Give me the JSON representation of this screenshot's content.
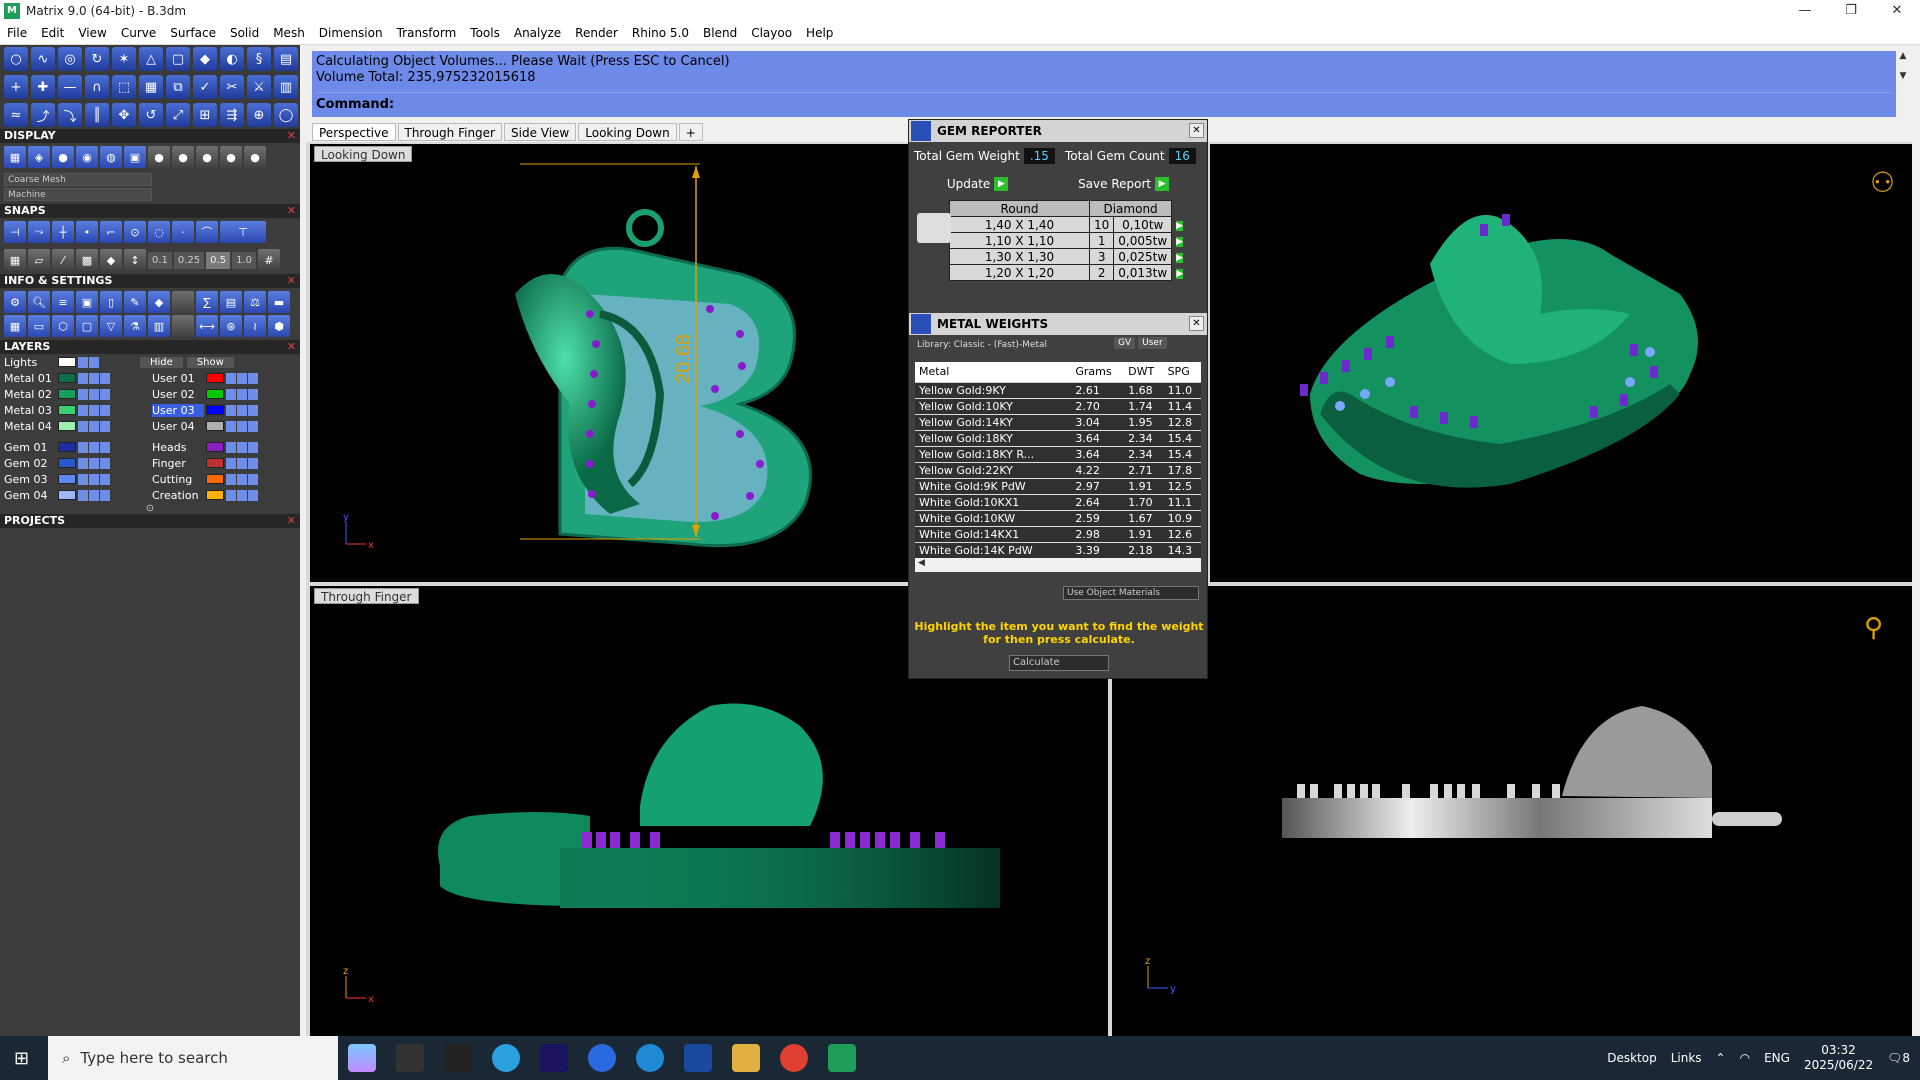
{
  "window": {
    "title": "Matrix 9.0 (64-bit) - B.3dm",
    "controls": {
      "minimize": "—",
      "maximize": "❐",
      "close": "✕"
    }
  },
  "menu": [
    "File",
    "Edit",
    "View",
    "Curve",
    "Surface",
    "Solid",
    "Mesh",
    "Dimension",
    "Transform",
    "Tools",
    "Analyze",
    "Render",
    "Rhino 5.0",
    "Blend",
    "Clayoo",
    "Help"
  ],
  "command": {
    "line1": "Calculating Object Volumes... Please Wait (Press ESC to Cancel)",
    "line2": "Volume Total: 235,975232015618",
    "prompt": "Command:"
  },
  "panels": {
    "display": {
      "title": "DISPLAY",
      "mesh": "Coarse Mesh",
      "material": "Machine"
    },
    "snaps": {
      "title": "SNAPS",
      "values": [
        "0.1",
        "0.25",
        "0.5",
        "1.0"
      ]
    },
    "info": {
      "title": "INFO & SETTINGS"
    },
    "layers": {
      "title": "LAYERS",
      "lights": "Lights",
      "hide": "Hide",
      "show": "Show",
      "left": [
        {
          "name": "Metal 01",
          "color": "#0f6e4a"
        },
        {
          "name": "Metal 02",
          "color": "#16a05a"
        },
        {
          "name": "Metal 03",
          "color": "#3ad070"
        },
        {
          "name": "Metal 04",
          "color": "#9ff0b0"
        },
        {
          "name": "Gem 01",
          "color": "#1a2fa0"
        },
        {
          "name": "Gem 02",
          "color": "#2858d0"
        },
        {
          "name": "Gem 03",
          "color": "#5a8af0"
        },
        {
          "name": "Gem 04",
          "color": "#9ab8f8"
        }
      ],
      "right": [
        {
          "name": "User 01",
          "color": "#ff0000"
        },
        {
          "name": "User 02",
          "color": "#00cc00"
        },
        {
          "name": "User 03",
          "color": "#0000ff",
          "selected": true
        },
        {
          "name": "User 04",
          "color": "#b0b0b0"
        },
        {
          "name": "Heads",
          "color": "#8a20c0"
        },
        {
          "name": "Finger",
          "color": "#c03030"
        },
        {
          "name": "Cutting",
          "color": "#ff6a00"
        },
        {
          "name": "Creation",
          "color": "#ffb000"
        }
      ]
    },
    "projects": {
      "title": "PROJECTS"
    }
  },
  "viewport_tabs": [
    "Perspective",
    "Through Finger",
    "Side View",
    "Looking Down",
    "+"
  ],
  "viewports": {
    "top_left": {
      "label": "Looking Down",
      "dimension": "20.68"
    },
    "bottom_left": {
      "label": "Through Finger"
    }
  },
  "gem_reporter": {
    "title": "GEM REPORTER",
    "total_weight_label": "Total Gem Weight",
    "total_weight": ".15",
    "total_count_label": "Total Gem Count",
    "total_count": "16",
    "update": "Update",
    "save_report": "Save Report",
    "headers": [
      "Round",
      "Diamond"
    ],
    "rows": [
      {
        "size": "1,40 X 1,40",
        "count": "10",
        "weight": "0,10tw"
      },
      {
        "size": "1,10 X 1,10",
        "count": "1",
        "weight": "0,005tw"
      },
      {
        "size": "1,30 X 1,30",
        "count": "3",
        "weight": "0,025tw"
      },
      {
        "size": "1,20 X 1,20",
        "count": "2",
        "weight": "0,013tw"
      }
    ]
  },
  "metal_weights": {
    "title": "METAL WEIGHTS",
    "library": "Library: Classic - (Fast)-Metal",
    "gv": "GV",
    "user": "User",
    "columns": [
      "Metal",
      "Grams",
      "DWT",
      "SPG"
    ],
    "rows": [
      {
        "metal": "Yellow Gold:9KY",
        "grams": "2.61",
        "dwt": "1.68",
        "spg": "11.0"
      },
      {
        "metal": "Yellow Gold:10KY",
        "grams": "2.70",
        "dwt": "1.74",
        "spg": "11.4"
      },
      {
        "metal": "Yellow Gold:14KY",
        "grams": "3.04",
        "dwt": "1.95",
        "spg": "12.8"
      },
      {
        "metal": "Yellow Gold:18KY",
        "grams": "3.64",
        "dwt": "2.34",
        "spg": "15.4"
      },
      {
        "metal": "Yellow Gold:18KY R...",
        "grams": "3.64",
        "dwt": "2.34",
        "spg": "15.4"
      },
      {
        "metal": "Yellow Gold:22KY",
        "grams": "4.22",
        "dwt": "2.71",
        "spg": "17.8"
      },
      {
        "metal": "White Gold:9K PdW",
        "grams": "2.97",
        "dwt": "1.91",
        "spg": "12.5"
      },
      {
        "metal": "White Gold:10KX1",
        "grams": "2.64",
        "dwt": "1.70",
        "spg": "11.1"
      },
      {
        "metal": "White Gold:10KW",
        "grams": "2.59",
        "dwt": "1.67",
        "spg": "10.9"
      },
      {
        "metal": "White Gold:14KX1",
        "grams": "2.98",
        "dwt": "1.91",
        "spg": "12.6"
      },
      {
        "metal": "White Gold:14K PdW",
        "grams": "3.39",
        "dwt": "2.18",
        "spg": "14.3"
      }
    ],
    "use_object_materials": "Use Object Materials",
    "hint": "Highlight the item you want to find the weight for then press calculate.",
    "calculate": "Calculate"
  },
  "taskbar": {
    "search_placeholder": "Type here to search",
    "desktop": "Desktop",
    "links": "Links",
    "lang": "ENG",
    "time": "03:32",
    "date": "2025/06/22",
    "notif": "8"
  }
}
